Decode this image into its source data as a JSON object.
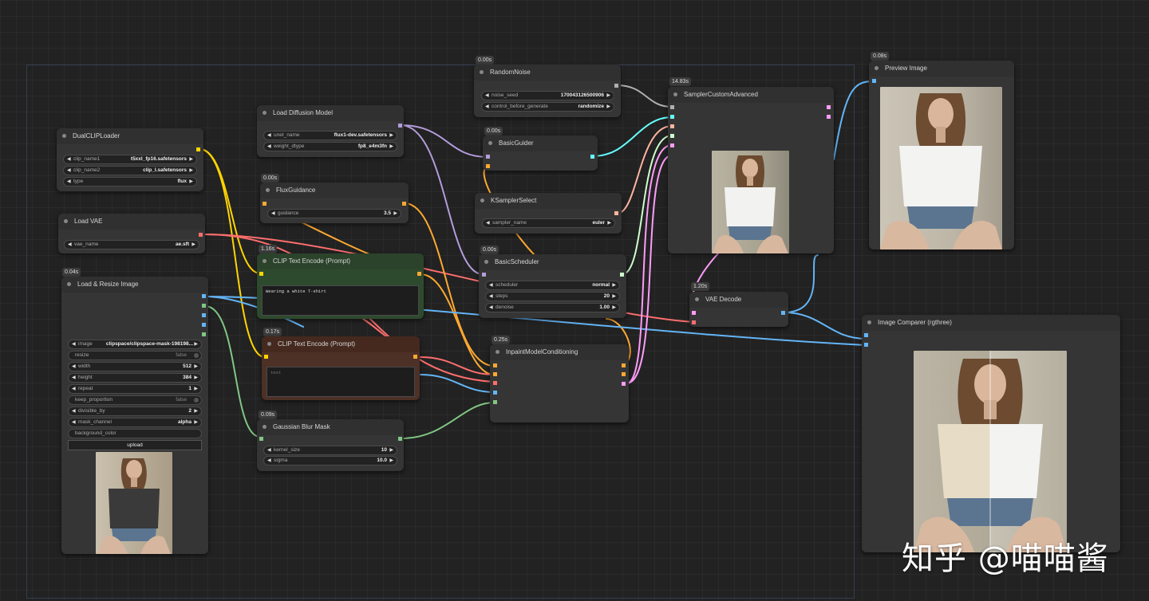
{
  "colors": {
    "background": "#222222",
    "node": "#353535",
    "clip_green": "#2d4a2d",
    "clip_brown": "#4d3026",
    "wire_clip": "#ffd500",
    "wire_model": "#b39ddb",
    "wire_vae": "#ff6e6e",
    "wire_conditioning": "#ffa931",
    "wire_latent": "#ff9cf9",
    "wire_image": "#64b5f6",
    "wire_mask": "#81c784",
    "wire_noise": "#b0b0b0",
    "wire_guider": "#66ffff",
    "wire_sigmas": "#cdffcd"
  },
  "nodes": {
    "dual_clip": {
      "title": "DualCLIPLoader",
      "widgets": [
        {
          "label": "clip_name1",
          "value": "t5xxl_fp16.safetensors"
        },
        {
          "label": "clip_name2",
          "value": "clip_l.safetensors"
        },
        {
          "label": "type",
          "value": "flux"
        }
      ]
    },
    "load_vae": {
      "title": "Load VAE",
      "widgets": [
        {
          "label": "vae_name",
          "value": "ae.sft"
        }
      ]
    },
    "load_resize": {
      "title": "Load & Resize Image",
      "timing": "0.04s",
      "image": {
        "label": "image",
        "value": "clipspace/clipspace-mask-198198..."
      },
      "resize": {
        "label": "resize",
        "value": "false"
      },
      "width": {
        "label": "width",
        "value": "512"
      },
      "height": {
        "label": "height",
        "value": "384"
      },
      "repeat": {
        "label": "repeat",
        "value": "1"
      },
      "keep_proportion": {
        "label": "keep_proportion",
        "value": "false"
      },
      "divisible_by": {
        "label": "divisible_by",
        "value": "2"
      },
      "mask_channel": {
        "label": "mask_channel",
        "value": "alpha"
      },
      "background_color": {
        "label": "background_color"
      },
      "upload": "upload"
    },
    "load_diffusion": {
      "title": "Load Diffusion Model",
      "widgets": [
        {
          "label": "unet_name",
          "value": "flux1-dev.safetensors"
        },
        {
          "label": "weight_dtype",
          "value": "fp8_e4m3fn"
        }
      ]
    },
    "flux_guidance": {
      "title": "FluxGuidance",
      "timing": "0.00s",
      "widgets": [
        {
          "label": "guidance",
          "value": "3.5"
        }
      ]
    },
    "clip_pos": {
      "title": "CLIP Text Encode (Prompt)",
      "timing": "1.16s",
      "text": "Wearing a white T-shirt"
    },
    "clip_neg": {
      "title": "CLIP Text Encode (Prompt)",
      "timing": "0.17s",
      "text": "text"
    },
    "gaussian": {
      "title": "Gaussian Blur Mask",
      "timing": "0.09s",
      "widgets": [
        {
          "label": "kernel_size",
          "value": "10"
        },
        {
          "label": "sigma",
          "value": "10.0"
        }
      ]
    },
    "random_noise": {
      "title": "RandomNoise",
      "timing": "0.00s",
      "widgets": [
        {
          "label": "noise_seed",
          "value": "170043126500906"
        },
        {
          "label": "control_before_generate",
          "value": "randomize"
        }
      ]
    },
    "basic_guider": {
      "title": "BasicGuider",
      "timing": "0.00s"
    },
    "ksampler_select": {
      "title": "KSamplerSelect",
      "widgets": [
        {
          "label": "sampler_name",
          "value": "euler"
        }
      ]
    },
    "basic_scheduler": {
      "title": "BasicScheduler",
      "timing": "0.00s",
      "widgets": [
        {
          "label": "scheduler",
          "value": "normal"
        },
        {
          "label": "steps",
          "value": "20"
        },
        {
          "label": "denoise",
          "value": "1.00"
        }
      ]
    },
    "inpaint_cond": {
      "title": "InpaintModelConditioning",
      "timing": "0.25s"
    },
    "sampler_custom": {
      "title": "SamplerCustomAdvanced",
      "timing": "14.83s"
    },
    "vae_decode": {
      "title": "VAE Decode",
      "timing": "1.20s"
    },
    "preview": {
      "title": "Preview Image",
      "timing": "0.08s"
    },
    "comparer": {
      "title": "Image Comparer (rgthree)"
    }
  },
  "watermark": "知乎 @喵喵酱"
}
